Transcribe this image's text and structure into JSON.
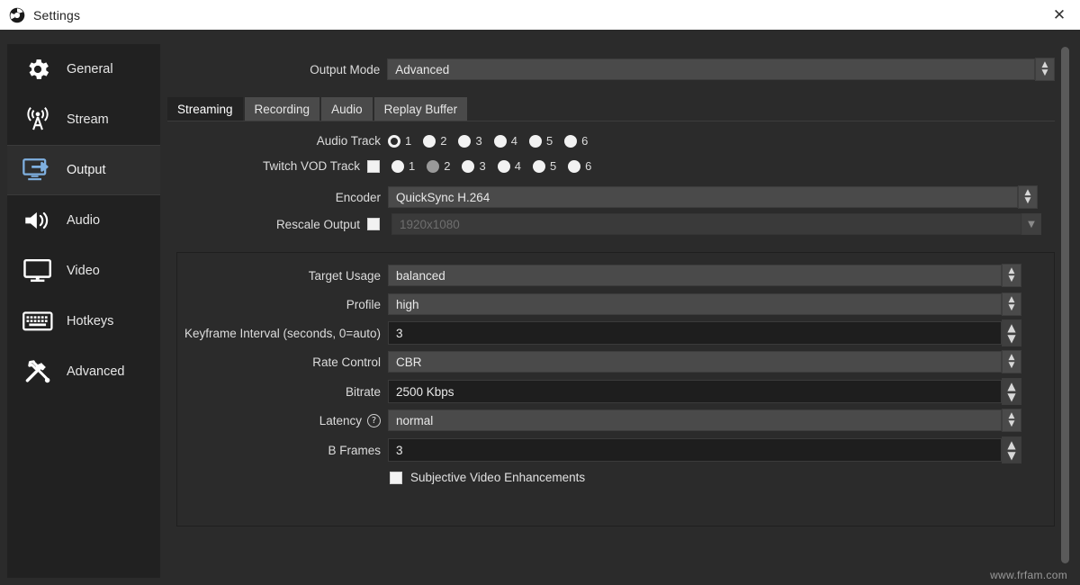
{
  "window": {
    "title": "Settings",
    "logo_icon": "obs-logo-icon",
    "close_icon": "close-icon",
    "close_glyph": "✕"
  },
  "sidebar": {
    "items": [
      {
        "label": "General",
        "icon": "gear-icon",
        "selected": false
      },
      {
        "label": "Stream",
        "icon": "broadcast-icon",
        "selected": false
      },
      {
        "label": "Output",
        "icon": "output-monitor-icon",
        "selected": true
      },
      {
        "label": "Audio",
        "icon": "speaker-icon",
        "selected": false
      },
      {
        "label": "Video",
        "icon": "monitor-icon",
        "selected": false
      },
      {
        "label": "Hotkeys",
        "icon": "keyboard-icon",
        "selected": false
      },
      {
        "label": "Advanced",
        "icon": "tools-icon",
        "selected": false
      }
    ]
  },
  "output_mode": {
    "label": "Output Mode",
    "value": "Advanced"
  },
  "tabs": [
    {
      "label": "Streaming",
      "active": true
    },
    {
      "label": "Recording",
      "active": false
    },
    {
      "label": "Audio",
      "active": false
    },
    {
      "label": "Replay Buffer",
      "active": false
    }
  ],
  "audio_track": {
    "label": "Audio Track",
    "options": [
      "1",
      "2",
      "3",
      "4",
      "5",
      "6"
    ],
    "selected": "1"
  },
  "twitch_vod_track": {
    "label": "Twitch VOD Track",
    "checkbox_checked": false,
    "options": [
      "1",
      "2",
      "3",
      "4",
      "5",
      "6"
    ],
    "selected": "2",
    "enabled": false
  },
  "encoder": {
    "label": "Encoder",
    "value": "QuickSync H.264"
  },
  "rescale_output": {
    "label": "Rescale Output",
    "checkbox_checked": false,
    "value": "1920x1080",
    "enabled": false
  },
  "encoder_settings": [
    {
      "label": "Target Usage",
      "value": "balanced",
      "type": "combo"
    },
    {
      "label": "Profile",
      "value": "high",
      "type": "combo"
    },
    {
      "label": "Keyframe Interval (seconds, 0=auto)",
      "value": "3",
      "type": "spin"
    },
    {
      "label": "Rate Control",
      "value": "CBR",
      "type": "combo"
    },
    {
      "label": "Bitrate",
      "value": "2500 Kbps",
      "type": "spin"
    },
    {
      "label": "Latency",
      "value": "normal",
      "type": "combo",
      "help": true,
      "help_glyph": "?"
    },
    {
      "label": "B Frames",
      "value": "3",
      "type": "spin"
    }
  ],
  "subjective_video_enhancements": {
    "label": "Subjective Video Enhancements",
    "checked": false
  },
  "watermark": "www.frfam.com",
  "colors": {
    "titlebar_bg": "#ffffff",
    "window_bg": "#2b2b2b",
    "sidebar_bg": "#212121",
    "selected_item_bg": "#2e2e2e",
    "accent_blue": "#6fa8dc",
    "combo_bg": "#4a4a4a",
    "spin_bg": "#1e1e1e",
    "text": "#e6e6e6"
  }
}
